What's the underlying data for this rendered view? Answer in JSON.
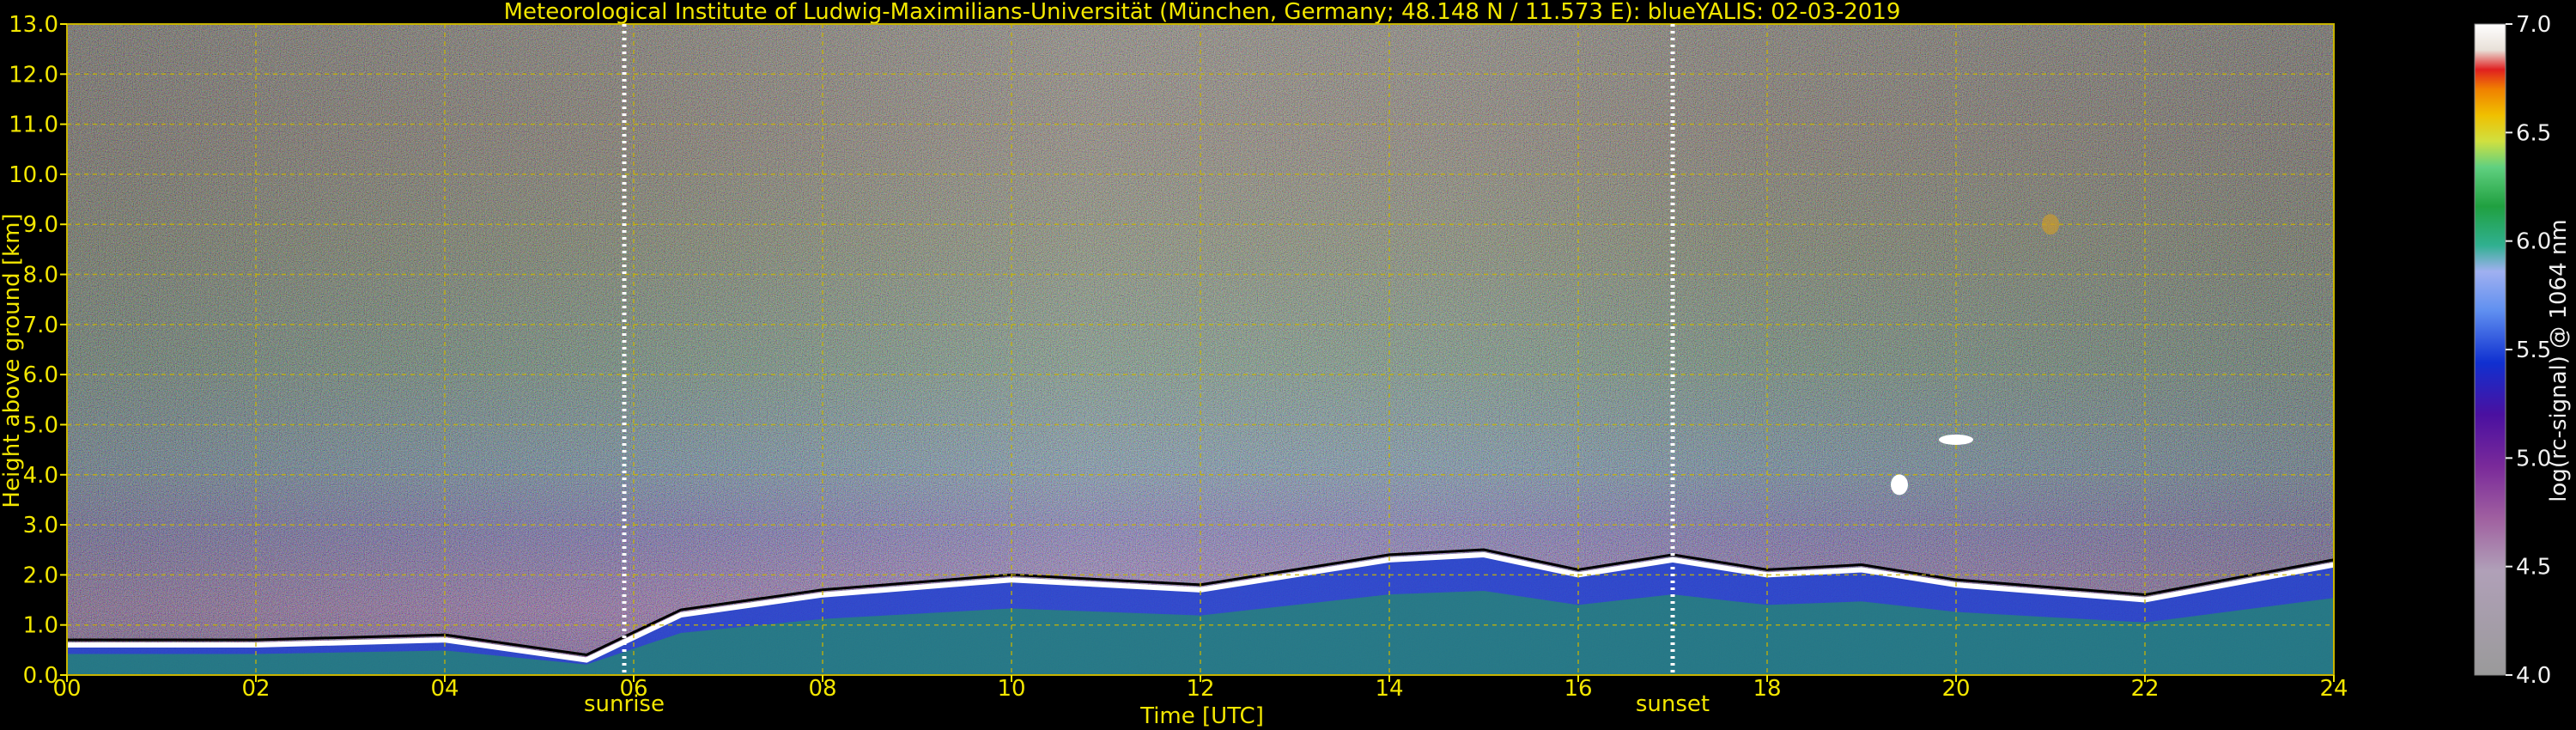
{
  "title": "Meteorological Institute of Ludwig-Maximilians-Universität (München, Germany; 48.148 N / 11.573 E):    blueYALIS: 02-03-2019",
  "chart_data": {
    "type": "heatmap",
    "title": "Meteorological Institute of Ludwig-Maximilians-Universität (München, Germany; 48.148 N / 11.573 E):    blueYALIS: 02-03-2019",
    "xlabel": "Time [UTC]",
    "ylabel": "Height above ground [km]",
    "xlim": [
      0,
      24
    ],
    "ylim": [
      0,
      13
    ],
    "xticks": [
      "00",
      "02",
      "04",
      "06",
      "08",
      "10",
      "12",
      "14",
      "16",
      "18",
      "20",
      "22",
      "24"
    ],
    "yticks": [
      "0.0",
      "1.0",
      "2.0",
      "3.0",
      "4.0",
      "5.0",
      "6.0",
      "7.0",
      "8.0",
      "9.0",
      "10.0",
      "11.0",
      "12.0",
      "13.0"
    ],
    "grid": true,
    "annotations": [
      {
        "label": "sunrise",
        "x": 5.9
      },
      {
        "label": "sunset",
        "x": 17.0
      }
    ],
    "colorbar": {
      "label": "log(rc-signal) @ 1064 nm",
      "range": [
        4.0,
        7.0
      ],
      "ticks": [
        "4.0",
        "4.5",
        "5.0",
        "5.5",
        "6.0",
        "6.5",
        "7.0"
      ]
    },
    "boundary_layer_top_km": [
      {
        "t": 0.0,
        "h": 0.6
      },
      {
        "t": 2.0,
        "h": 0.6
      },
      {
        "t": 4.0,
        "h": 0.7
      },
      {
        "t": 5.5,
        "h": 0.3
      },
      {
        "t": 6.5,
        "h": 1.2
      },
      {
        "t": 8.0,
        "h": 1.6
      },
      {
        "t": 10.0,
        "h": 1.9
      },
      {
        "t": 12.0,
        "h": 1.7
      },
      {
        "t": 13.0,
        "h": 2.0
      },
      {
        "t": 14.0,
        "h": 2.3
      },
      {
        "t": 15.0,
        "h": 2.4
      },
      {
        "t": 16.0,
        "h": 2.0
      },
      {
        "t": 17.0,
        "h": 2.3
      },
      {
        "t": 18.0,
        "h": 2.0
      },
      {
        "t": 19.0,
        "h": 2.1
      },
      {
        "t": 20.0,
        "h": 1.8
      },
      {
        "t": 22.0,
        "h": 1.5
      },
      {
        "t": 24.0,
        "h": 2.2
      }
    ],
    "features": [
      {
        "t": 20.0,
        "h": 4.7
      },
      {
        "t": 21.0,
        "h": 9.0
      },
      {
        "t": 19.4,
        "h": 3.8
      }
    ]
  },
  "colors": {
    "background": "#000000",
    "text": "#f2e600",
    "grid": "#c8b400",
    "markers": "#ffffff"
  }
}
